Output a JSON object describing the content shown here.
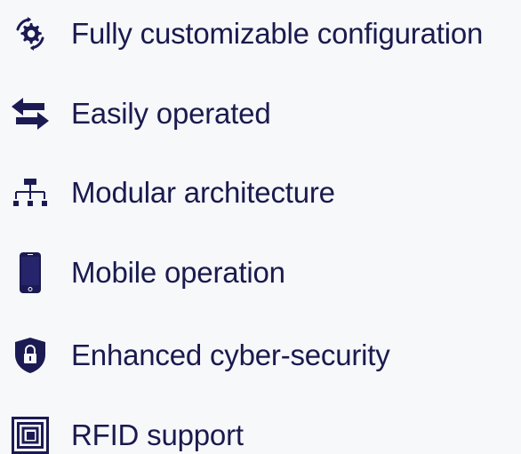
{
  "colors": {
    "background": "#f7f8fa",
    "text": "#1a1a4e",
    "icon": "#1c1a52"
  },
  "features": [
    {
      "label": "Fully customizable configuration",
      "icon": "gear-cycle-icon"
    },
    {
      "label": "Easily operated",
      "icon": "swap-arrows-icon"
    },
    {
      "label": "Modular architecture",
      "icon": "hierarchy-icon"
    },
    {
      "label": "Mobile operation",
      "icon": "smartphone-icon"
    },
    {
      "label": "Enhanced cyber-security",
      "icon": "shield-lock-icon"
    },
    {
      "label": "RFID support",
      "icon": "rfid-card-icon"
    }
  ]
}
